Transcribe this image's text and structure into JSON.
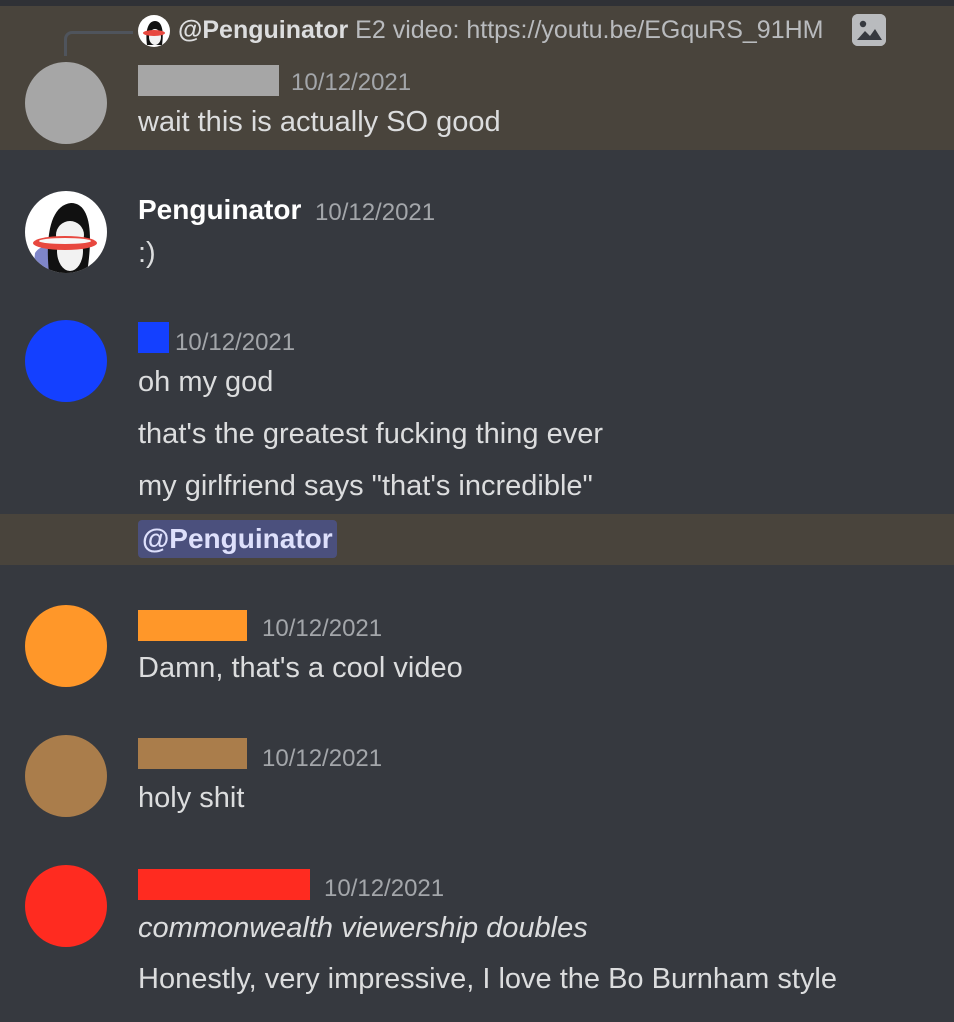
{
  "reply": {
    "author": "@Penguinator",
    "content": "E2 video: https://youtu.be/EGquRS_91HM",
    "attachment_icon": "image-icon"
  },
  "messages": [
    {
      "id": "m1",
      "author_redacted": true,
      "redact_color": "#a6a6a6",
      "timestamp": "10/12/2021",
      "lines": [
        "wait this is actually SO good"
      ]
    },
    {
      "id": "m2",
      "author": "Penguinator",
      "timestamp": "10/12/2021",
      "lines": [
        ":)"
      ]
    },
    {
      "id": "m3",
      "author_redacted": true,
      "redact_color": "#1440ff",
      "timestamp": "10/12/2021",
      "lines": [
        "oh my god",
        "that's the greatest fucking thing ever",
        "my girlfriend says \"that's incredible\""
      ],
      "mention": "@Penguinator"
    },
    {
      "id": "m4",
      "author_redacted": true,
      "redact_color": "#ff9729",
      "timestamp": "10/12/2021",
      "lines": [
        "Damn, that's a cool video"
      ]
    },
    {
      "id": "m5",
      "author_redacted": true,
      "redact_color": "#aa7d4b",
      "timestamp": "10/12/2021",
      "lines": [
        "holy shit"
      ]
    },
    {
      "id": "m6",
      "author_redacted": true,
      "redact_color": "#ff2b20",
      "timestamp": "10/12/2021",
      "lines": [
        "commonwealth viewership doubles",
        "Honestly, very impressive, I love the Bo  Burnham style"
      ]
    }
  ],
  "colors": {
    "background": "#36393f",
    "highlight": "#49443c",
    "mention_bg": "#4b507d"
  }
}
